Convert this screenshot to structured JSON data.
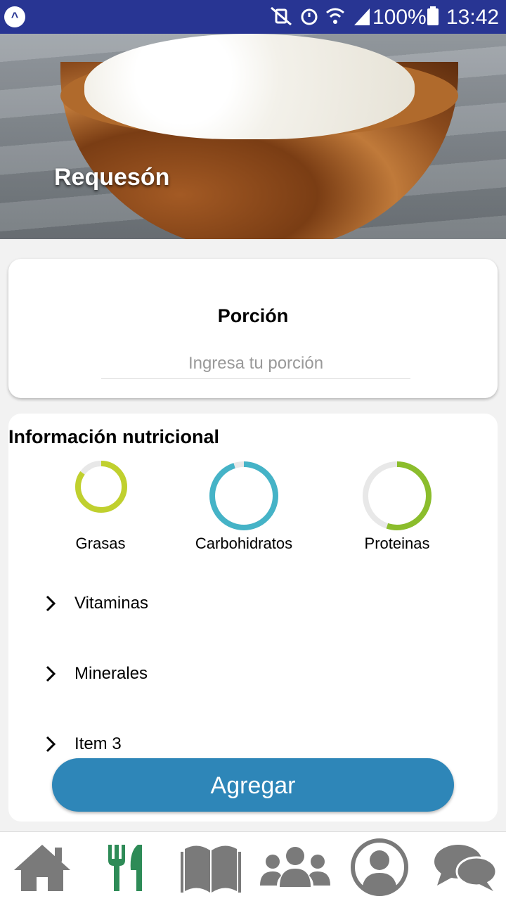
{
  "status_bar": {
    "battery": "100%",
    "time": "13:42"
  },
  "hero": {
    "title": "Requesón"
  },
  "portion": {
    "label": "Porción",
    "placeholder": "Ingresa tu porción"
  },
  "nutrition": {
    "heading": "Información nutricional",
    "rings": [
      {
        "label": "Grasas",
        "color": "#c0d02e",
        "fraction": 0.85
      },
      {
        "label": "Carbohidratos",
        "color": "#45b3c7",
        "fraction": 0.95
      },
      {
        "label": "Proteinas",
        "color": "#8bbd2c",
        "fraction": 0.55
      }
    ],
    "rows": [
      {
        "label": "Vitaminas"
      },
      {
        "label": "Minerales"
      },
      {
        "label": "Item 3"
      }
    ]
  },
  "action": {
    "add_label": "Agregar"
  },
  "bottom_nav": [
    {
      "icon": "home-icon",
      "color": "#7a7a7a"
    },
    {
      "icon": "utensils-icon",
      "color": "#2e8b57"
    },
    {
      "icon": "book-icon",
      "color": "#7a7a7a"
    },
    {
      "icon": "users-icon",
      "color": "#7a7a7a"
    },
    {
      "icon": "profile-icon",
      "color": "#7a7a7a"
    },
    {
      "icon": "chat-icon",
      "color": "#7a7a7a"
    }
  ]
}
